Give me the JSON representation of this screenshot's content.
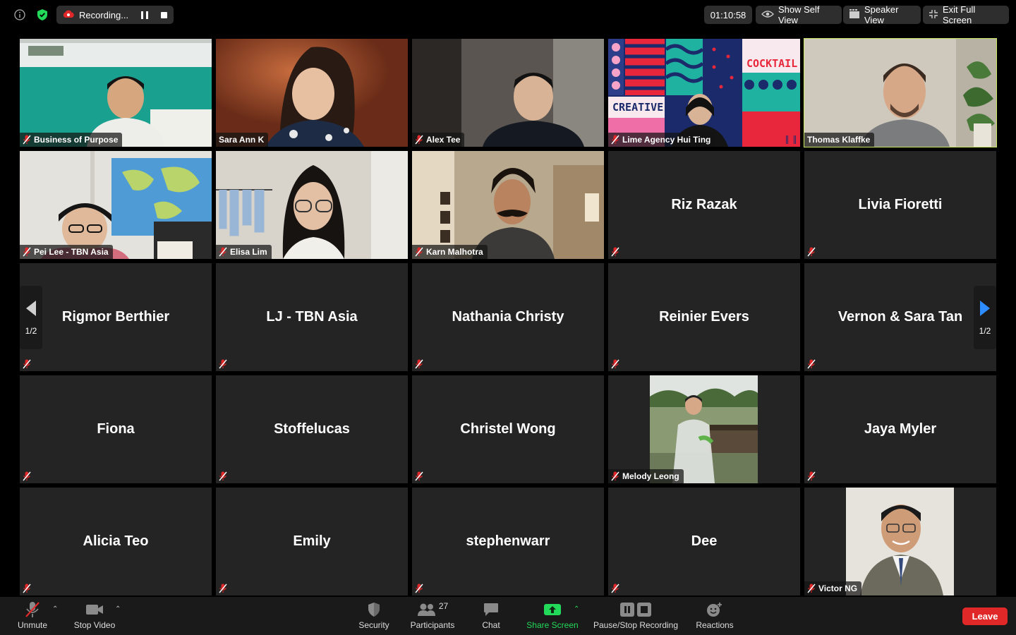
{
  "top_bar": {
    "recording_label": "Recording...",
    "timer": "01:10:58",
    "show_self_view": "Show Self View",
    "speaker_view": "Speaker View",
    "exit_full_screen": "Exit Full Screen"
  },
  "participants": [
    {
      "name": "Business of Purpose"
    },
    {
      "name": "Sara Ann K"
    },
    {
      "name": "Alex Tee"
    },
    {
      "name": "Lime Agency Hui Ting",
      "banner_top": "COCKTAIL",
      "banner_left": "CREATIVE"
    },
    {
      "name": "Thomas Klaffke"
    },
    {
      "name": "Pei Lee - TBN Asia"
    },
    {
      "name": "Elisa Lim"
    },
    {
      "name": "Karn Malhotra"
    },
    {
      "name": "Riz Razak"
    },
    {
      "name": "Livia Fioretti"
    },
    {
      "name": "Rigmor Berthier"
    },
    {
      "name": "LJ - TBN Asia"
    },
    {
      "name": "Nathania Christy"
    },
    {
      "name": "Reinier Evers"
    },
    {
      "name": "Vernon & Sara Tan"
    },
    {
      "name": "Fiona"
    },
    {
      "name": "Stoffelucas"
    },
    {
      "name": "Christel Wong"
    },
    {
      "name": "Melody Leong"
    },
    {
      "name": "Jaya Myler"
    },
    {
      "name": "Alicia Teo"
    },
    {
      "name": "Emily"
    },
    {
      "name": "stephenwarr"
    },
    {
      "name": "Dee"
    },
    {
      "name": "Victor NG"
    }
  ],
  "pager": {
    "left": "1/2",
    "right": "1/2"
  },
  "toolbar": {
    "unmute": "Unmute",
    "stop_video": "Stop Video",
    "security": "Security",
    "participants": "Participants",
    "participants_count": "27",
    "chat": "Chat",
    "share_screen": "Share Screen",
    "pause_stop_recording": "Pause/Stop Recording",
    "reactions": "Reactions",
    "leave": "Leave"
  },
  "colors": {
    "active_speaker_border": "#c8e864",
    "share_green": "#23d959",
    "leave_red": "#e02828",
    "mute_red": "#e0282a",
    "tile_bg": "#242424"
  }
}
